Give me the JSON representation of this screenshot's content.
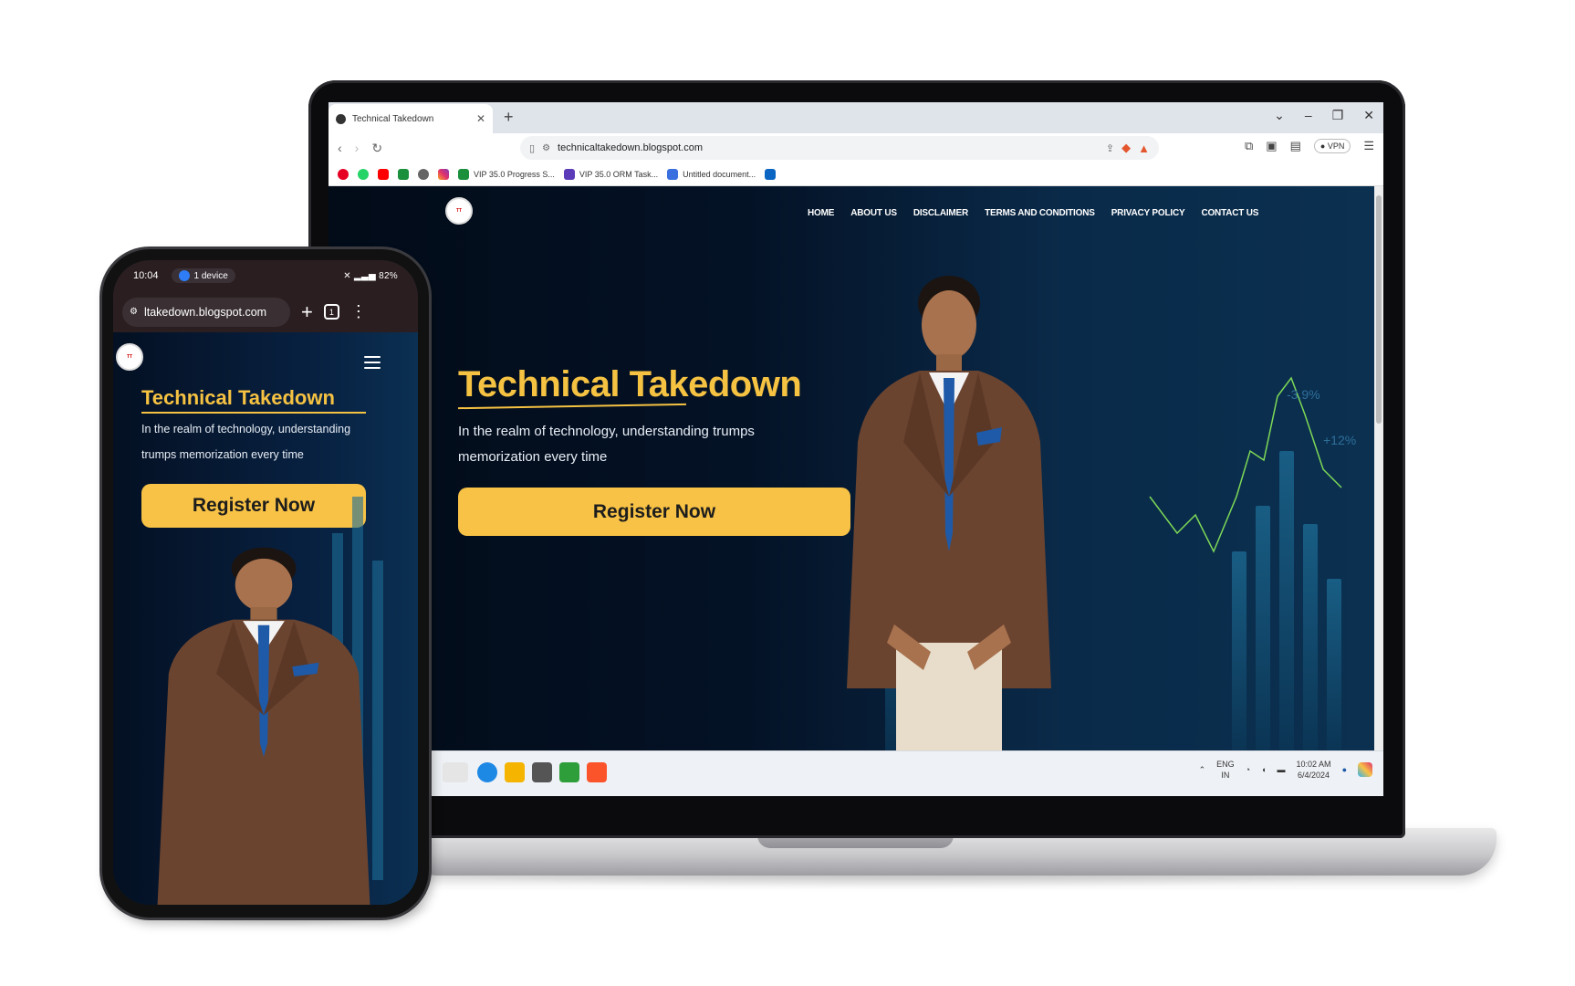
{
  "laptop": {
    "browser": {
      "tab_title": "Technical Takedown",
      "new_tab_symbol": "+",
      "url": "technicaltakedown.blogspot.com",
      "vpn_label": "VPN",
      "bookmarks": [
        {
          "label": "VIP 35.0 Progress S...",
          "color": "#1a8f3c"
        },
        {
          "label": "VIP 35.0 ORM Task...",
          "color": "#5b3bb7"
        },
        {
          "label": "Untitled document...",
          "color": "#3a6fe0"
        }
      ]
    },
    "site": {
      "nav": [
        "HOME",
        "ABOUT US",
        "DISCLAIMER",
        "TERMS AND CONDITIONS",
        "PRIVACY POLICY",
        "CONTACT US"
      ],
      "title": "Technical Takedown",
      "subtitle": "In the realm of technology, understanding trumps memorization every time",
      "cta": "Register Now",
      "chart_labels": [
        "-3.9%",
        "+12%"
      ]
    },
    "taskbar": {
      "lang": "ENG",
      "region": "IN",
      "time": "10:02 AM",
      "date": "6/4/2024"
    }
  },
  "phone": {
    "status": {
      "time": "10:04",
      "device_badge": "1 device",
      "battery": "82%"
    },
    "url": "ltakedown.blogspot.com",
    "tab_count": "1",
    "site": {
      "title": "Technical Takedown",
      "subtitle": "In the realm of technology, understanding trumps memorization every time",
      "cta": "Register Now"
    }
  },
  "colors": {
    "accent_yellow": "#f7c245",
    "page_navy": "#041226",
    "jacket_brown": "#6b4430",
    "tie_blue": "#1e5aa8"
  }
}
